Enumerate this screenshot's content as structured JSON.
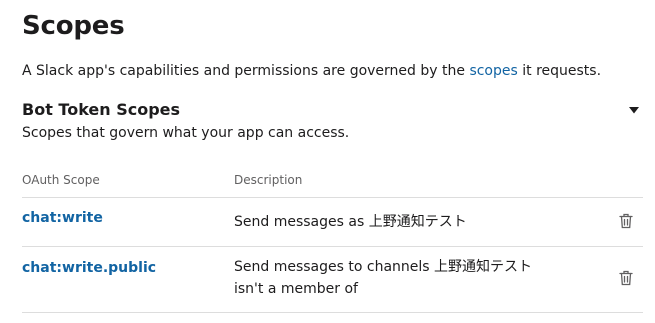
{
  "header": {
    "title": "Scopes"
  },
  "intro": {
    "prefix": "A Slack app's capabilities and permissions are governed by the ",
    "link": "scopes",
    "suffix": " it requests."
  },
  "bot_scopes": {
    "title": "Bot Token Scopes",
    "subtitle": "Scopes that govern what your app can access.",
    "toggle_icon": "caret-down-icon",
    "columns": {
      "scope": "OAuth Scope",
      "description": "Description"
    },
    "rows": [
      {
        "scope": "chat:write",
        "description": "Send messages as 上野通知テスト",
        "action_icon": "trash-icon"
      },
      {
        "scope": "chat:write.public",
        "description": "Send messages to channels 上野通知テスト isn't a member of",
        "action_icon": "trash-icon"
      }
    ]
  },
  "colors": {
    "link": "#1264a3",
    "text": "#1d1c1d",
    "muted": "#616061",
    "divider": "#dddddd"
  }
}
